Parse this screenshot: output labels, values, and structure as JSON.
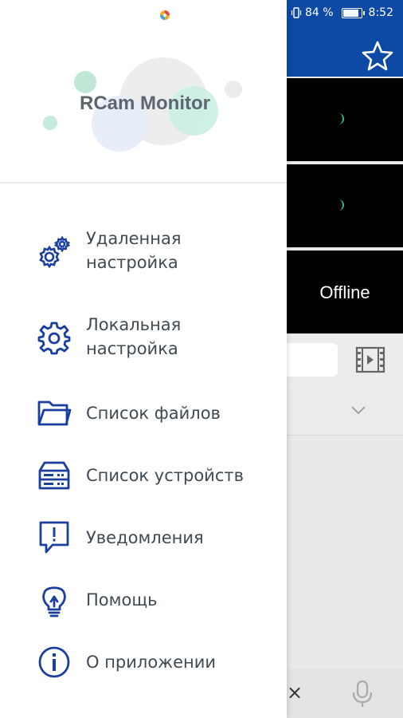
{
  "status_bar": {
    "battery_percent": "84 %",
    "time": "8:52",
    "battery_level": 0.84
  },
  "drawer": {
    "app_title": "RCam Monitor",
    "menu": [
      {
        "line1": "Удаленная",
        "line2": "настройка",
        "icon": "remote-settings-gears-icon"
      },
      {
        "line1": "Локальная",
        "line2": "настройка",
        "icon": "gear-icon"
      },
      {
        "line1": "Список файлов",
        "line2": "",
        "icon": "folder-icon"
      },
      {
        "line1": "Список устройств",
        "line2": "",
        "icon": "server-icon"
      },
      {
        "line1": "Уведомления",
        "line2": "",
        "icon": "alert-message-icon"
      },
      {
        "line1": "Помощь",
        "line2": "",
        "icon": "lightbulb-icon"
      },
      {
        "line1": "О приложении",
        "line2": "",
        "icon": "info-icon"
      }
    ]
  },
  "background": {
    "camera_3_status": "Offline",
    "close_symbol": "×"
  },
  "colors": {
    "primary": "#0d4aa6",
    "icon_blue": "#1b3fa0",
    "text": "#404a52",
    "title": "#5b6670"
  }
}
